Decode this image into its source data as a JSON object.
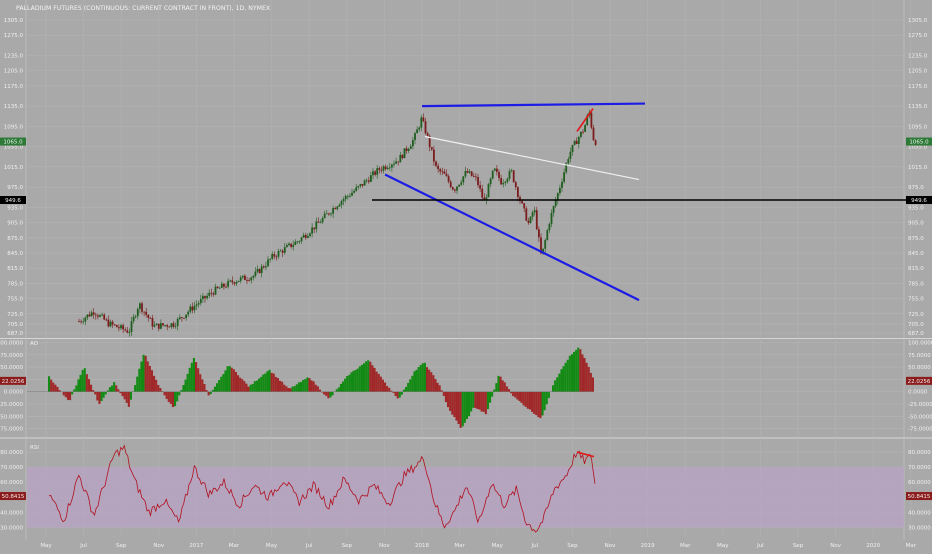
{
  "title": "PALLADIUM FUTURES (CONTINUOUS: CURRENT CONTRACT IN FRONT), 1D, NYMEX",
  "colors": {
    "background": "#a9a9a9",
    "grid": "#b6b6b6",
    "candle_up": "#1f5e1f",
    "candle_down": "#7a1c1c",
    "trend_blue": "#1c1ce6",
    "trend_white": "#f2f2f2",
    "trend_red": "#e01818",
    "support_black": "#000000",
    "ao_up": "#138a13",
    "ao_down": "#a02828",
    "rsi_line": "#b0101e",
    "rsi_band": "#b9a3c6"
  },
  "chart_data": [
    {
      "type": "candlestick",
      "name": "price",
      "y_ticks": [
        1305.0,
        1275.0,
        1235.0,
        1205.0,
        1175.0,
        1135.0,
        1095.0,
        1055.0,
        1015.0,
        975.0,
        935.0,
        905.0,
        875.0,
        845.0,
        815.0,
        785.0,
        755.0,
        725.0,
        705.0,
        687.0
      ],
      "x_labels": [
        "May",
        "Jul",
        "Sep",
        "Nov",
        "2017",
        "Mar",
        "May",
        "Jul",
        "Sep",
        "Nov",
        "2018",
        "Mar",
        "May",
        "Jul",
        "Sep",
        "Nov",
        "2019",
        "Mar",
        "May",
        "Jul",
        "Sep",
        "Nov",
        "2020",
        "Mar"
      ],
      "last_price": 1065.0,
      "level_marker": 949.6,
      "anchors": [
        {
          "t": 0,
          "v": 700
        },
        {
          "t": 0.06,
          "v": 710
        },
        {
          "t": 0.09,
          "v": 730
        },
        {
          "t": 0.12,
          "v": 705
        },
        {
          "t": 0.16,
          "v": 690
        },
        {
          "t": 0.18,
          "v": 745
        },
        {
          "t": 0.21,
          "v": 700
        },
        {
          "t": 0.25,
          "v": 705
        },
        {
          "t": 0.29,
          "v": 740
        },
        {
          "t": 0.33,
          "v": 770
        },
        {
          "t": 0.37,
          "v": 790
        },
        {
          "t": 0.41,
          "v": 800
        },
        {
          "t": 0.45,
          "v": 840
        },
        {
          "t": 0.5,
          "v": 870
        },
        {
          "t": 0.54,
          "v": 905
        },
        {
          "t": 0.58,
          "v": 945
        },
        {
          "t": 0.62,
          "v": 975
        },
        {
          "t": 0.66,
          "v": 1010
        },
        {
          "t": 0.7,
          "v": 1030
        },
        {
          "t": 0.73,
          "v": 1070
        },
        {
          "t": 0.745,
          "v": 1110
        },
        {
          "t": 0.755,
          "v": 1080
        },
        {
          "t": 0.775,
          "v": 1010
        },
        {
          "t": 0.79,
          "v": 1000
        },
        {
          "t": 0.81,
          "v": 970
        },
        {
          "t": 0.835,
          "v": 1005
        },
        {
          "t": 0.855,
          "v": 990
        },
        {
          "t": 0.87,
          "v": 945
        },
        {
          "t": 0.89,
          "v": 1010
        },
        {
          "t": 0.905,
          "v": 985
        },
        {
          "t": 0.925,
          "v": 1005
        },
        {
          "t": 0.94,
          "v": 955
        },
        {
          "t": 0.96,
          "v": 900
        },
        {
          "t": 0.97,
          "v": 935
        },
        {
          "t": 0.985,
          "v": 835
        },
        {
          "t": 1.0,
          "v": 905
        },
        {
          "t": 1.02,
          "v": 970
        },
        {
          "t": 1.04,
          "v": 1040
        },
        {
          "t": 1.06,
          "v": 1075
        },
        {
          "t": 1.07,
          "v": 1090
        },
        {
          "t": 1.08,
          "v": 1125
        },
        {
          "t": 1.09,
          "v": 1065
        }
      ],
      "trendlines": [
        {
          "color": "trend_blue",
          "v1": 1135,
          "v2": 1140
        },
        {
          "color": "trend_blue",
          "v1": 1000,
          "v2": 752
        },
        {
          "color": "trend_white",
          "v1": 1075,
          "v2": 990
        },
        {
          "color": "support_black",
          "v1": 949.6,
          "v2": 949.6
        },
        {
          "color": "trend_red",
          "v1": 1085,
          "v2": 1130
        }
      ]
    },
    {
      "type": "histogram",
      "name": "AO",
      "label": "AO",
      "y_ticks": [
        100.0,
        75.0,
        50.0,
        25.0,
        0.0,
        -25.0,
        -50.0,
        -75.0
      ],
      "last_value": 22.0256,
      "ylim": [
        -90,
        105
      ],
      "anchors": [
        {
          "t": 0,
          "v": 30
        },
        {
          "t": 0.04,
          "v": -20
        },
        {
          "t": 0.07,
          "v": 50
        },
        {
          "t": 0.1,
          "v": -25
        },
        {
          "t": 0.13,
          "v": 20
        },
        {
          "t": 0.16,
          "v": -30
        },
        {
          "t": 0.19,
          "v": 80
        },
        {
          "t": 0.22,
          "v": 10
        },
        {
          "t": 0.25,
          "v": -35
        },
        {
          "t": 0.29,
          "v": 70
        },
        {
          "t": 0.32,
          "v": -10
        },
        {
          "t": 0.36,
          "v": 55
        },
        {
          "t": 0.4,
          "v": 10
        },
        {
          "t": 0.44,
          "v": 45
        },
        {
          "t": 0.48,
          "v": 5
        },
        {
          "t": 0.52,
          "v": 30
        },
        {
          "t": 0.56,
          "v": -15
        },
        {
          "t": 0.6,
          "v": 35
        },
        {
          "t": 0.64,
          "v": 65
        },
        {
          "t": 0.67,
          "v": 20
        },
        {
          "t": 0.7,
          "v": -15
        },
        {
          "t": 0.73,
          "v": 40
        },
        {
          "t": 0.75,
          "v": 60
        },
        {
          "t": 0.78,
          "v": 15
        },
        {
          "t": 0.8,
          "v": -35
        },
        {
          "t": 0.825,
          "v": -75
        },
        {
          "t": 0.85,
          "v": -30
        },
        {
          "t": 0.875,
          "v": -45
        },
        {
          "t": 0.9,
          "v": 35
        },
        {
          "t": 0.93,
          "v": -10
        },
        {
          "t": 0.96,
          "v": -35
        },
        {
          "t": 0.985,
          "v": -55
        },
        {
          "t": 1.01,
          "v": 20
        },
        {
          "t": 1.04,
          "v": 70
        },
        {
          "t": 1.06,
          "v": 90
        },
        {
          "t": 1.075,
          "v": 60
        },
        {
          "t": 1.09,
          "v": 22
        }
      ]
    },
    {
      "type": "line",
      "name": "RSI",
      "label": "RSI",
      "y_ticks": [
        80.0,
        70.0,
        60.0,
        50.0,
        40.0,
        30.0
      ],
      "last_value": 50.8415,
      "band": [
        30,
        70
      ],
      "ylim": [
        25,
        88
      ],
      "anchors": [
        {
          "t": 0,
          "v": 52
        },
        {
          "t": 0.03,
          "v": 35
        },
        {
          "t": 0.06,
          "v": 65
        },
        {
          "t": 0.09,
          "v": 38
        },
        {
          "t": 0.13,
          "v": 78
        },
        {
          "t": 0.15,
          "v": 83
        },
        {
          "t": 0.17,
          "v": 62
        },
        {
          "t": 0.2,
          "v": 40
        },
        {
          "t": 0.23,
          "v": 48
        },
        {
          "t": 0.26,
          "v": 33
        },
        {
          "t": 0.29,
          "v": 70
        },
        {
          "t": 0.32,
          "v": 52
        },
        {
          "t": 0.35,
          "v": 60
        },
        {
          "t": 0.38,
          "v": 45
        },
        {
          "t": 0.41,
          "v": 58
        },
        {
          "t": 0.44,
          "v": 50
        },
        {
          "t": 0.47,
          "v": 62
        },
        {
          "t": 0.5,
          "v": 47
        },
        {
          "t": 0.53,
          "v": 58
        },
        {
          "t": 0.56,
          "v": 44
        },
        {
          "t": 0.59,
          "v": 62
        },
        {
          "t": 0.62,
          "v": 48
        },
        {
          "t": 0.65,
          "v": 58
        },
        {
          "t": 0.68,
          "v": 46
        },
        {
          "t": 0.71,
          "v": 64
        },
        {
          "t": 0.73,
          "v": 70
        },
        {
          "t": 0.75,
          "v": 76
        },
        {
          "t": 0.77,
          "v": 48
        },
        {
          "t": 0.79,
          "v": 31
        },
        {
          "t": 0.81,
          "v": 40
        },
        {
          "t": 0.835,
          "v": 58
        },
        {
          "t": 0.86,
          "v": 33
        },
        {
          "t": 0.885,
          "v": 60
        },
        {
          "t": 0.91,
          "v": 45
        },
        {
          "t": 0.935,
          "v": 55
        },
        {
          "t": 0.955,
          "v": 33
        },
        {
          "t": 0.975,
          "v": 28
        },
        {
          "t": 0.99,
          "v": 36
        },
        {
          "t": 1.01,
          "v": 55
        },
        {
          "t": 1.035,
          "v": 65
        },
        {
          "t": 1.055,
          "v": 80
        },
        {
          "t": 1.07,
          "v": 74
        },
        {
          "t": 1.085,
          "v": 77
        },
        {
          "t": 1.095,
          "v": 51
        }
      ],
      "divergence": [
        80,
        77
      ]
    }
  ]
}
